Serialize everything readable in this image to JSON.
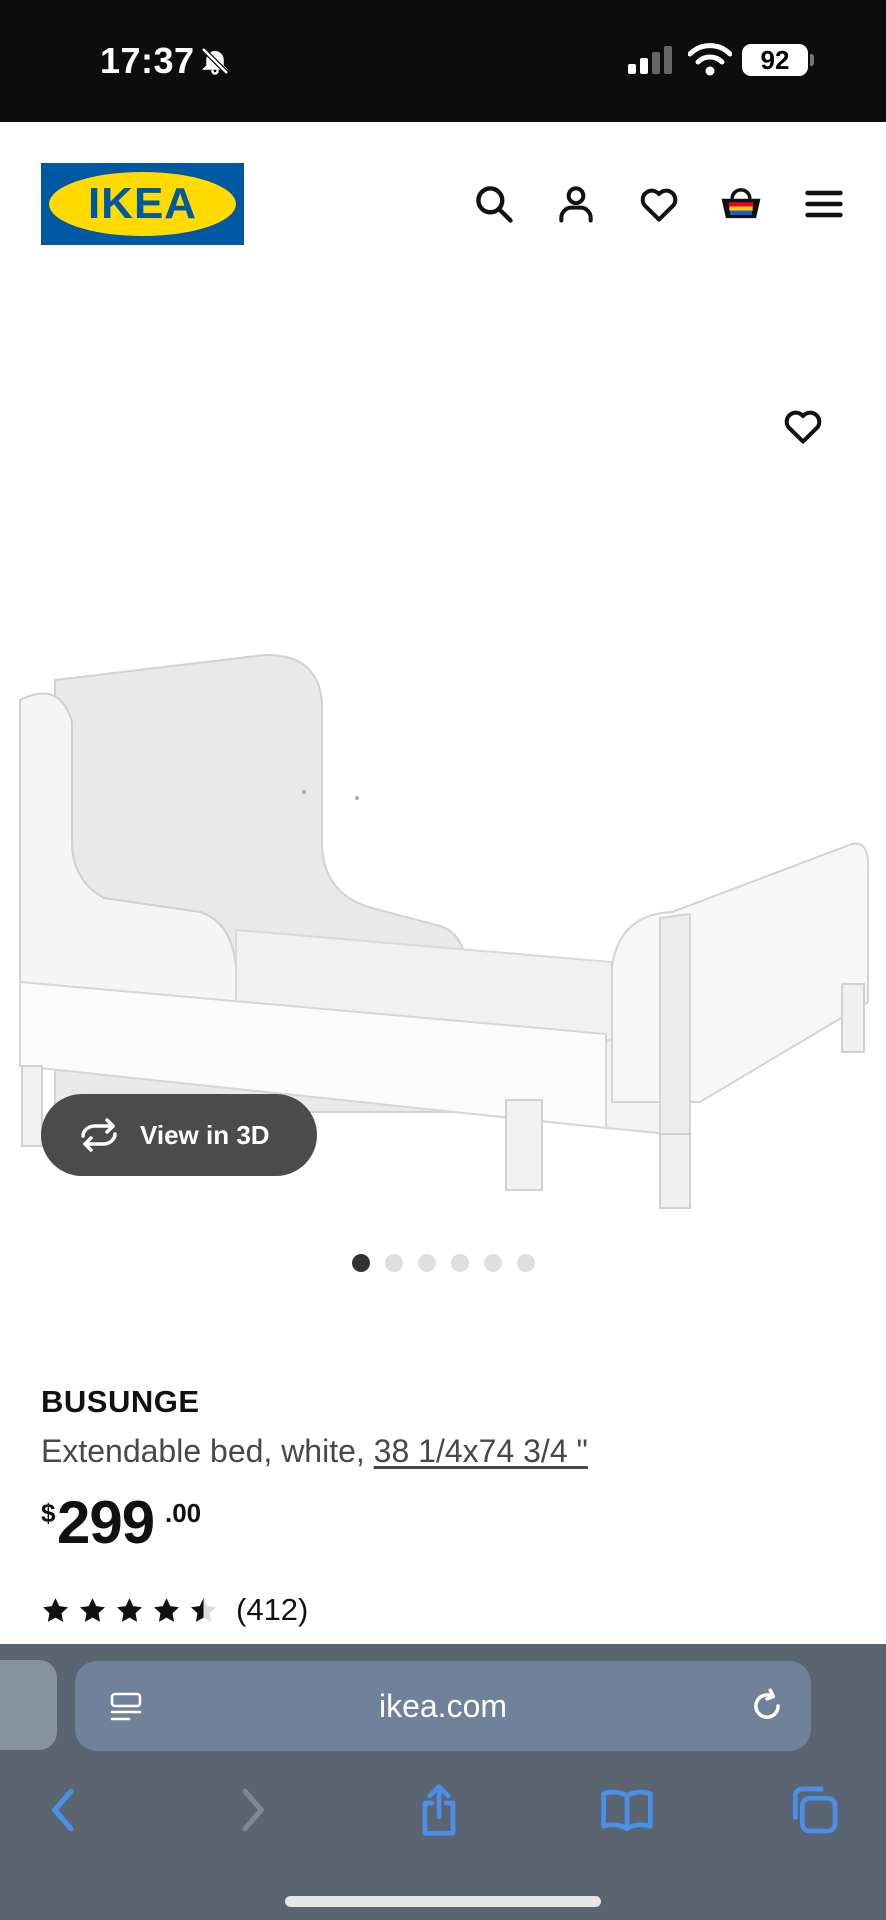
{
  "status_bar": {
    "time": "17:37",
    "battery": "92",
    "icons": [
      "bell-slash-icon",
      "cellular-signal-icon",
      "wifi-icon",
      "battery-icon"
    ]
  },
  "header": {
    "logo_text": "IKEA",
    "icons": [
      "search-icon",
      "account-icon",
      "heart-icon",
      "basket-icon",
      "menu-icon"
    ]
  },
  "gallery": {
    "image": "extendable-bed-photo",
    "view_3d_label": "View in 3D",
    "image_count": 6,
    "active_index": 0
  },
  "product": {
    "name": "BUSUNGE",
    "description": "Extendable bed, white, ",
    "size_link": "38 1/4x74 3/4 \"",
    "price_currency": "$",
    "price_integer": "299",
    "price_decimal": ".00",
    "rating_value": 4.5,
    "rating_max": 5,
    "review_count": "(412)"
  },
  "browser": {
    "url": "ikea.com",
    "toolbar_icons": [
      "back-icon",
      "forward-icon",
      "share-icon",
      "bookmarks-icon",
      "tabs-icon"
    ]
  },
  "colors": {
    "ikea_blue": "#0058a3",
    "ikea_yellow": "#ffdb00",
    "view_3d_button": "#4b4b4b",
    "browser_bar": "#5b6571",
    "browser_accent": "#4a8fe8"
  }
}
